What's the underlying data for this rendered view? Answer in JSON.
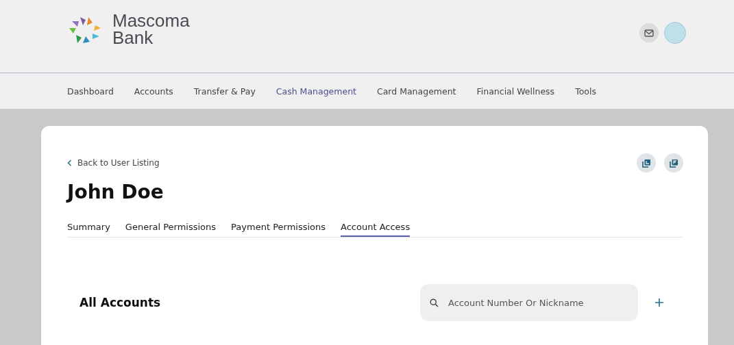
{
  "brand": {
    "line1": "Mascoma",
    "line2": "Bank"
  },
  "nav": [
    {
      "label": "Dashboard",
      "selected": false
    },
    {
      "label": "Accounts",
      "selected": false
    },
    {
      "label": "Transfer & Pay",
      "selected": false
    },
    {
      "label": "Cash Management",
      "selected": true
    },
    {
      "label": "Card Management",
      "selected": false
    },
    {
      "label": "Financial Wellness",
      "selected": false
    },
    {
      "label": "Tools",
      "selected": false
    }
  ],
  "back_link": "Back to User Listing",
  "user_name": "John Doe",
  "tabs": [
    {
      "label": "Summary",
      "selected": false
    },
    {
      "label": "General Permissions",
      "selected": false
    },
    {
      "label": "Payment Permissions",
      "selected": false
    },
    {
      "label": "Account Access",
      "selected": true
    }
  ],
  "section_title": "All Accounts",
  "search": {
    "placeholder": "Account Number Or Nickname"
  }
}
